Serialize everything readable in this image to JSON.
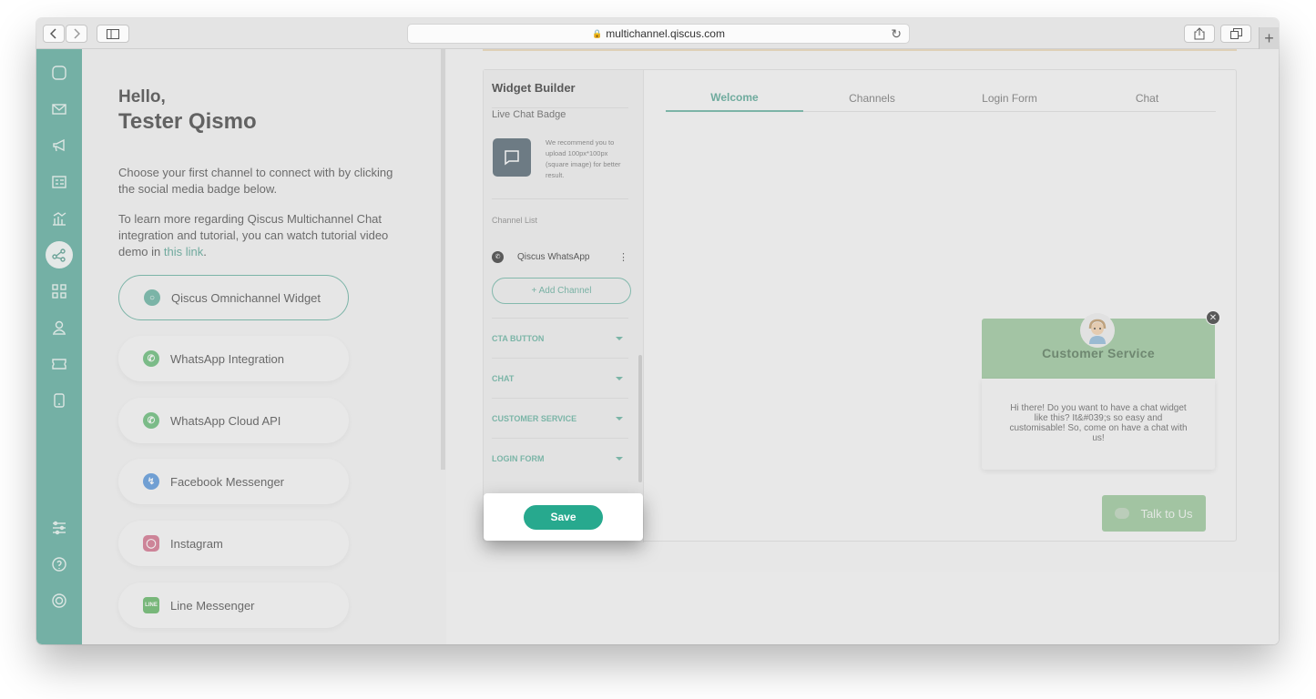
{
  "browser": {
    "url": "multichannel.qiscus.com",
    "lock_icon": "lock-icon",
    "reload_icon": "reload-icon"
  },
  "sidebar": {
    "items": [
      {
        "icon": "chat-icon"
      },
      {
        "icon": "mail-icon"
      },
      {
        "icon": "megaphone-icon"
      },
      {
        "icon": "contact-card-icon"
      },
      {
        "icon": "analytics-icon"
      },
      {
        "icon": "integration-icon",
        "active": true
      },
      {
        "icon": "apps-grid-icon"
      },
      {
        "icon": "user-icon"
      },
      {
        "icon": "ticket-icon"
      },
      {
        "icon": "mobile-icon"
      },
      {
        "icon": "settings-sliders-icon"
      },
      {
        "icon": "help-icon"
      },
      {
        "icon": "power-icon"
      }
    ]
  },
  "left_panel": {
    "hello": "Hello,",
    "name": "Tester Qismo",
    "intro": "Choose your first channel to connect with by clicking the social media badge below.",
    "learn_more_prefix": "To learn more regarding Qiscus Multichannel Chat integration and tutorial, you can watch tutorial video demo in ",
    "learn_more_link": "this link",
    "learn_more_suffix": ".",
    "channels": [
      {
        "label": "Qiscus Omnichannel Widget",
        "icon": "qiscus-icon",
        "color": "#7cbcae",
        "selected": true
      },
      {
        "label": "WhatsApp Integration",
        "icon": "whatsapp-icon",
        "color": "#7cc48a"
      },
      {
        "label": "WhatsApp Cloud API",
        "icon": "whatsapp-icon",
        "color": "#7cc48a"
      },
      {
        "label": "Facebook Messenger",
        "icon": "messenger-icon",
        "color": "#6fa4e0"
      },
      {
        "label": "Instagram",
        "icon": "instagram-icon",
        "color": "#d9869c"
      },
      {
        "label": "Line Messenger",
        "icon": "line-icon",
        "color": "#78c07a"
      }
    ]
  },
  "widget_builder": {
    "title": "Widget Builder",
    "badge_label": "Live Chat Badge",
    "badge_note": "We recommend you to upload 100px*100px (square image) for better result.",
    "channel_list_label": "Channel List",
    "channel_name": "Qiscus WhatsApp",
    "add_channel": "+ Add Channel",
    "sections": [
      "CTA BUTTON",
      "CHAT",
      "CUSTOMER SERVICE",
      "LOGIN FORM"
    ],
    "tabs": [
      {
        "label": "Welcome",
        "active": true
      },
      {
        "label": "Channels"
      },
      {
        "label": "Login Form"
      },
      {
        "label": "Chat"
      }
    ]
  },
  "preview": {
    "header": "Customer Service",
    "message": "Hi there! Do you want to have a chat widget like this? It&#039;s so easy and customisable! So, come on have a chat with us!",
    "talk_button": "Talk to Us"
  },
  "save_label": "Save"
}
